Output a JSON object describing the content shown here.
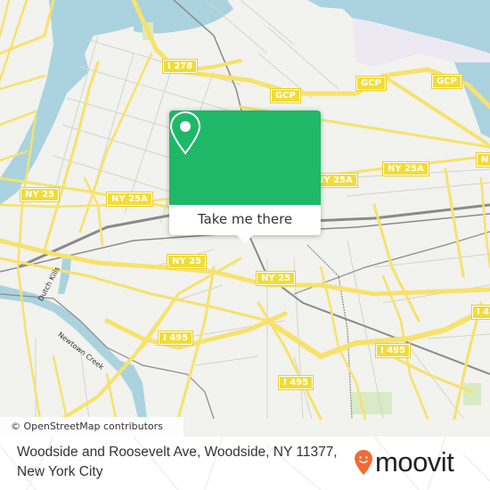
{
  "map": {
    "road_labels": [
      {
        "text": "I 278",
        "id": "shield-i278-a"
      },
      {
        "text": "GCP",
        "id": "shield-gcp-a"
      },
      {
        "text": "GCP",
        "id": "shield-gcp-b"
      },
      {
        "text": "GCP",
        "id": "shield-gcp-c"
      },
      {
        "text": "NY 25",
        "id": "shield-ny25-a"
      },
      {
        "text": "NY 25A",
        "id": "shield-ny25a-a"
      },
      {
        "text": "NY 25A",
        "id": "shield-ny25a-b"
      },
      {
        "text": "NY 25A",
        "id": "shield-ny25a-c"
      },
      {
        "text": "NY 25",
        "id": "shield-ny25-b"
      },
      {
        "text": "NY 25",
        "id": "shield-ny25-c"
      },
      {
        "text": "I 495",
        "id": "shield-i495-a"
      },
      {
        "text": "I 495",
        "id": "shield-i495-b"
      },
      {
        "text": "I 495",
        "id": "shield-i495-c"
      },
      {
        "text": "I 4",
        "id": "shield-i495-d"
      },
      {
        "text": "N",
        "id": "shield-ny-e"
      }
    ],
    "water_labels": {
      "dutch_kills": "Dutch Kills",
      "newtown_creek": "Newtown Creek"
    },
    "colors": {
      "land": "#f2f2ee",
      "water": "#aad3df",
      "road": "#f7e26b",
      "road_casing": "#e8cf2a",
      "rail": "#777777",
      "park": "#d8ebc5"
    }
  },
  "attribution": "© OpenStreetMap contributors",
  "popup": {
    "button_label": "Take me there",
    "icon": "location-pin-icon",
    "color": "#1eb868"
  },
  "footer": {
    "address_line1": "Woodside and Roosevelt Ave, Woodside, NY 11377,",
    "address_line2": "New York City",
    "logo_text": "moovit",
    "logo_color": "#f26b33"
  }
}
